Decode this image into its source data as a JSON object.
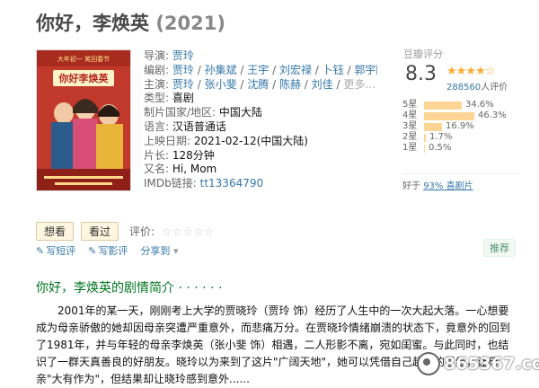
{
  "movie": {
    "title": "你好，李焕英",
    "year": "(2021)"
  },
  "poster": {
    "top_banner": "大年初一 笑回春节",
    "calligraphy": "你好李焕英",
    "bg_color": "#c0392b"
  },
  "info": {
    "director_label": "导演:",
    "director": "贾玲",
    "writers_label": "编剧:",
    "writers": [
      "贾玲",
      "孙集斌",
      "王宇",
      "刘宏禄",
      "卜钰",
      "郭宇鹏"
    ],
    "cast_label": "主演:",
    "cast": [
      "贾玲",
      "张小斐",
      "沈腾",
      "陈赫",
      "刘佳"
    ],
    "cast_more": "更多...",
    "genre_label": "类型:",
    "genre": "喜剧",
    "country_label": "制片国家/地区:",
    "country": "中国大陆",
    "language_label": "语言:",
    "language": "汉语普通话",
    "release_label": "上映日期:",
    "release": "2021-02-12(中国大陆)",
    "runtime_label": "片长:",
    "runtime": "128分钟",
    "aka_label": "又名:",
    "aka": "Hi, Mom",
    "imdb_label": "IMDb链接:",
    "imdb": "tt13364790"
  },
  "rating": {
    "label": "豆瓣评分",
    "score": "8.3",
    "stars": "★★★★☆",
    "count": "288560",
    "count_suffix": "人评价",
    "distribution": [
      {
        "label": "5星",
        "pct": "34.6%",
        "value": 34.6
      },
      {
        "label": "4星",
        "pct": "46.3%",
        "value": 46.3
      },
      {
        "label": "3星",
        "pct": "16.9%",
        "value": 16.9
      },
      {
        "label": "2星",
        "pct": "1.7%",
        "value": 1.7
      },
      {
        "label": "1星",
        "pct": "0.5%",
        "value": 0.5
      }
    ],
    "better_prefix": "好于",
    "better_link": "93% 喜剧片",
    "bar_color": "#ffd596",
    "star_color": "#ffac2d"
  },
  "actions": {
    "want": "想看",
    "seen": "看过",
    "rate_label": "评价:",
    "rate_stars": "☆☆☆☆☆",
    "write_short": "写短评",
    "write_review": "写影评",
    "share": "分享到",
    "share_arrow": "▾",
    "recommend": "推荐"
  },
  "synopsis": {
    "title": "你好，李焕英的剧情简介 · · · · · ·",
    "text": "2001年的某一天，刚刚考上大学的贾晓玲（贾玲 饰）经历了人生中的一次大起大落。一心想要成为母亲骄傲的她却因母亲突遭严重意外，而悲痛万分。在贾晓玲情绪崩溃的状态下，竟意外的回到了1981年，并与年轻的母亲李焕英（张小斐 饰）相遇，二人形影不离，宛如闺蜜。与此同时，也结识了一群天真善良的好朋友。晓玲以为来到了这片\"广阔天地\"，她可以凭借自己超前的思维，让母亲\"大有作为\"，但结果却让晓玲感到意外......"
  },
  "watermark": {
    "text": "865367.com"
  }
}
